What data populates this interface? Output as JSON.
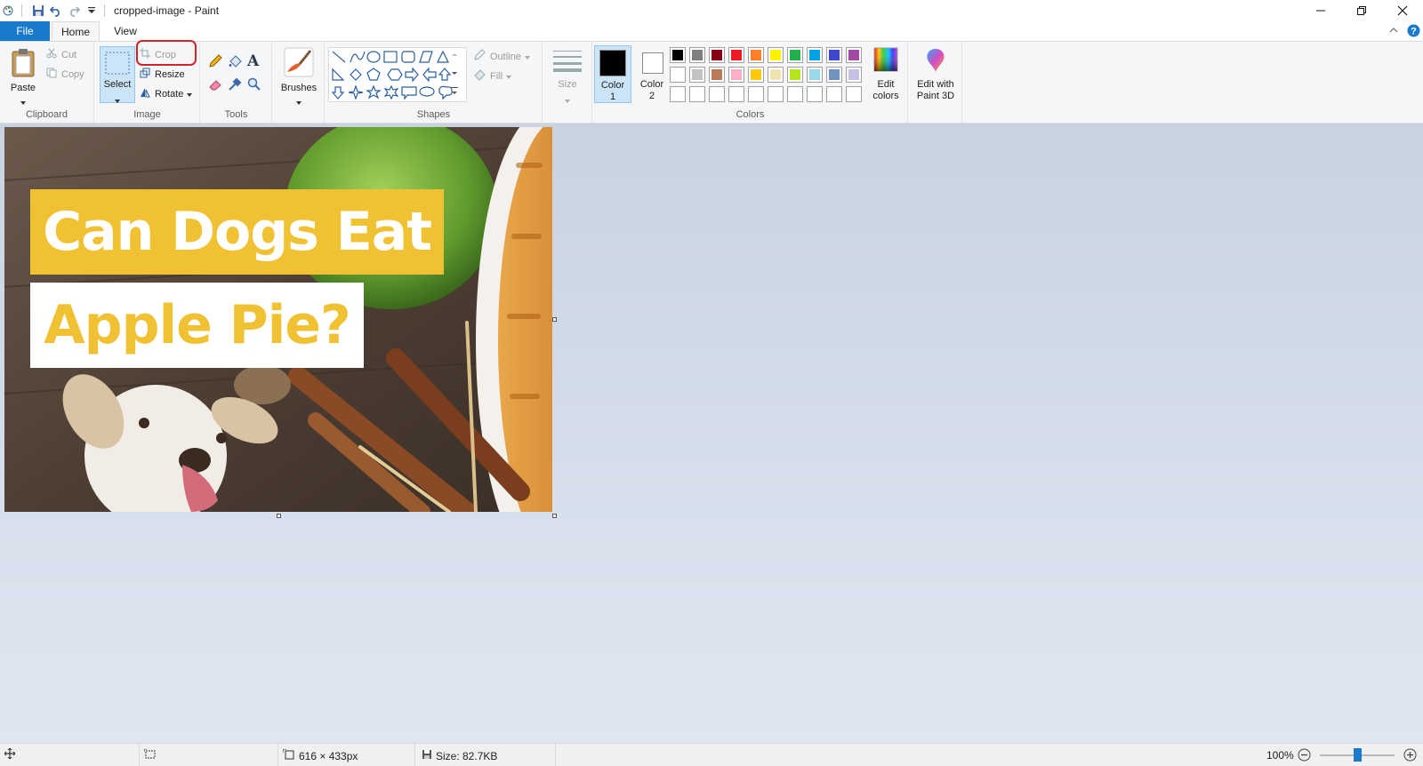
{
  "window": {
    "title": "cropped-image - Paint"
  },
  "tabs": {
    "file": "File",
    "home": "Home",
    "view": "View"
  },
  "clipboard": {
    "paste": "Paste",
    "cut": "Cut",
    "copy": "Copy",
    "group_label": "Clipboard"
  },
  "image_group": {
    "select": "Select",
    "crop": "Crop",
    "resize": "Resize",
    "rotate": "Rotate",
    "group_label": "Image"
  },
  "tools": {
    "group_label": "Tools"
  },
  "brushes": {
    "label": "Brushes"
  },
  "shapes": {
    "outline": "Outline",
    "fill": "Fill",
    "group_label": "Shapes"
  },
  "size": {
    "label": "Size"
  },
  "colors": {
    "color1_line1": "Color",
    "color1_line2": "1",
    "color2_line1": "Color",
    "color2_line2": "2",
    "edit_line1": "Edit",
    "edit_line2": "colors",
    "group_label": "Colors",
    "color1_value": "#000000",
    "color2_value": "#ffffff",
    "palette_row1": [
      "#000000",
      "#7f7f7f",
      "#880015",
      "#ed1c24",
      "#ff7f27",
      "#fff200",
      "#22b14c",
      "#00a2e8",
      "#3f48cc",
      "#a349a4"
    ],
    "palette_row2": [
      "#ffffff",
      "#c3c3c3",
      "#b97a57",
      "#ffaec9",
      "#ffc90e",
      "#efe4b0",
      "#b5e61d",
      "#99d9ea",
      "#7092be",
      "#c8bfe7"
    ],
    "palette_row3": [
      "#ffffff",
      "#ffffff",
      "#ffffff",
      "#ffffff",
      "#ffffff",
      "#ffffff",
      "#ffffff",
      "#ffffff",
      "#ffffff",
      "#ffffff"
    ]
  },
  "paint3d": {
    "line1": "Edit with",
    "line2": "Paint 3D"
  },
  "image_content": {
    "line1": "Can Dogs Eat",
    "line2": "Apple Pie?"
  },
  "status": {
    "dimensions": "616 × 433px",
    "size": "Size: 82.7KB",
    "zoom": "100%",
    "zoom_level": 1.0
  },
  "highlight_color": "#d2232a",
  "accent_color": "#1979ca"
}
